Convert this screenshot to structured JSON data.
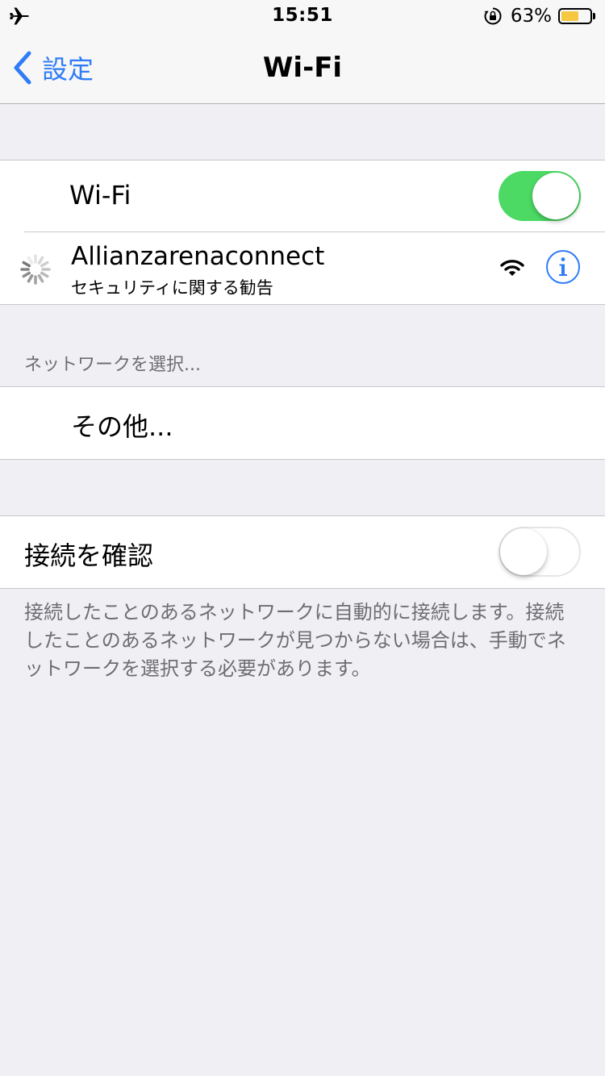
{
  "status_bar": {
    "time": "15:51",
    "battery_percent": "63%",
    "battery_level": 0.63,
    "battery_color": "#f5c842",
    "left_icon": "airplane-icon",
    "right_icons": [
      "rotation-lock-icon",
      "battery-icon"
    ]
  },
  "nav": {
    "back_label": "設定",
    "title": "Wi-Fi"
  },
  "wifi_toggle": {
    "label": "Wi-Fi",
    "state": "on"
  },
  "current_network": {
    "name": "Allianzarenaconnect",
    "subtitle": "セキュリティに関する勧告",
    "icons": [
      "loading-spinner-icon",
      "wifi-signal-icon",
      "info-icon"
    ]
  },
  "networks_section": {
    "header": "ネットワークを選択...",
    "other_label": "その他..."
  },
  "ask_to_join": {
    "label": "接続を確認",
    "state": "off",
    "footer": "接続したことのあるネットワークに自動的に接続します。接続したことのあるネットワークが見つからない場合は、手動でネットワークを選択する必要があります。"
  },
  "colors": {
    "accent": "#2f7cf6",
    "toggle_on": "#4cd964",
    "background": "#efeff4"
  }
}
